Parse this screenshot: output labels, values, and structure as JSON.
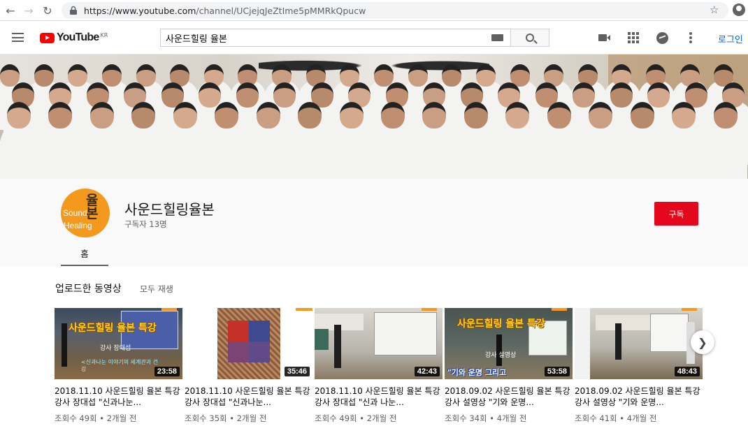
{
  "browser": {
    "url_host": "https://www.youtube.com",
    "url_path": "/channel/UCjejqJeZtIme5pMMRkQpucw"
  },
  "masthead": {
    "logo_text": "YouTube",
    "country_code": "KR",
    "search_value": "사운드힐링 율본",
    "login_label": "로그인"
  },
  "channel": {
    "name": "사운드힐링율본",
    "subscribers": "구독자 13명",
    "subscribe_label": "구독",
    "avatar_text_1": "Sound",
    "avatar_text_2": "Healing",
    "avatar_hanja": "율본",
    "tab_home": "홈"
  },
  "shelf": {
    "title": "업로드한 동영상",
    "play_all": "모두 재생"
  },
  "videos": [
    {
      "duration": "23:58",
      "title": "2018.11.10 사운드힐링 율본 특강 강사 장대섭 \"신과나눈...",
      "meta": "조회수 49회 • 2개월 전",
      "overlay": "사운드힐링 율본 특강",
      "overlay_sub": "강사 장대섭",
      "overlay_sub2": "<신과나눈 이야기의 세계관과 건강"
    },
    {
      "duration": "35:46",
      "title": "2018.11.10 사운드힐링 율본 특강 강사 장대섭 \"신과나눈...",
      "meta": "조회수 35회 • 2개월 전"
    },
    {
      "duration": "42:43",
      "title": "2018.11.10 사운드힐링 율본 특강 강사 장대섭 \"신과 나눈...",
      "meta": "조회수 49회 • 2개월 전"
    },
    {
      "duration": "53:58",
      "title": "2018.09.02 사운드힐링 율본 특강 강사 설영상 \"기와 운명...",
      "meta": "조회수 34회 • 4개월 전",
      "overlay": "사운드힐링 율본 특강",
      "overlay_sub": "강사 설영상",
      "overlay_sub2": "\"기와 운명 그리고"
    },
    {
      "duration": "48:43",
      "title": "2018.09.02 사운드힐링 율본 특강 강사 설영상 \"기와 운명...",
      "meta": "조회수 41회 • 4개월 전"
    }
  ],
  "icons": {
    "back": "arrow-left-icon",
    "forward": "arrow-right-icon",
    "reload": "reload-icon",
    "lock": "lock-icon",
    "star": "star-icon",
    "account": "account-icon",
    "menu": "hamburger-icon",
    "keyboard": "keyboard-icon",
    "search": "search-icon",
    "create": "video-camera-icon",
    "apps": "apps-grid-icon",
    "messages": "messages-icon",
    "more": "more-vert-icon",
    "next": "chevron-right-icon"
  },
  "colors": {
    "brand_red": "#ff0000",
    "subscribe_red": "#e5071b",
    "link_blue": "#065fd4",
    "avatar_orange": "#f39a1e"
  }
}
